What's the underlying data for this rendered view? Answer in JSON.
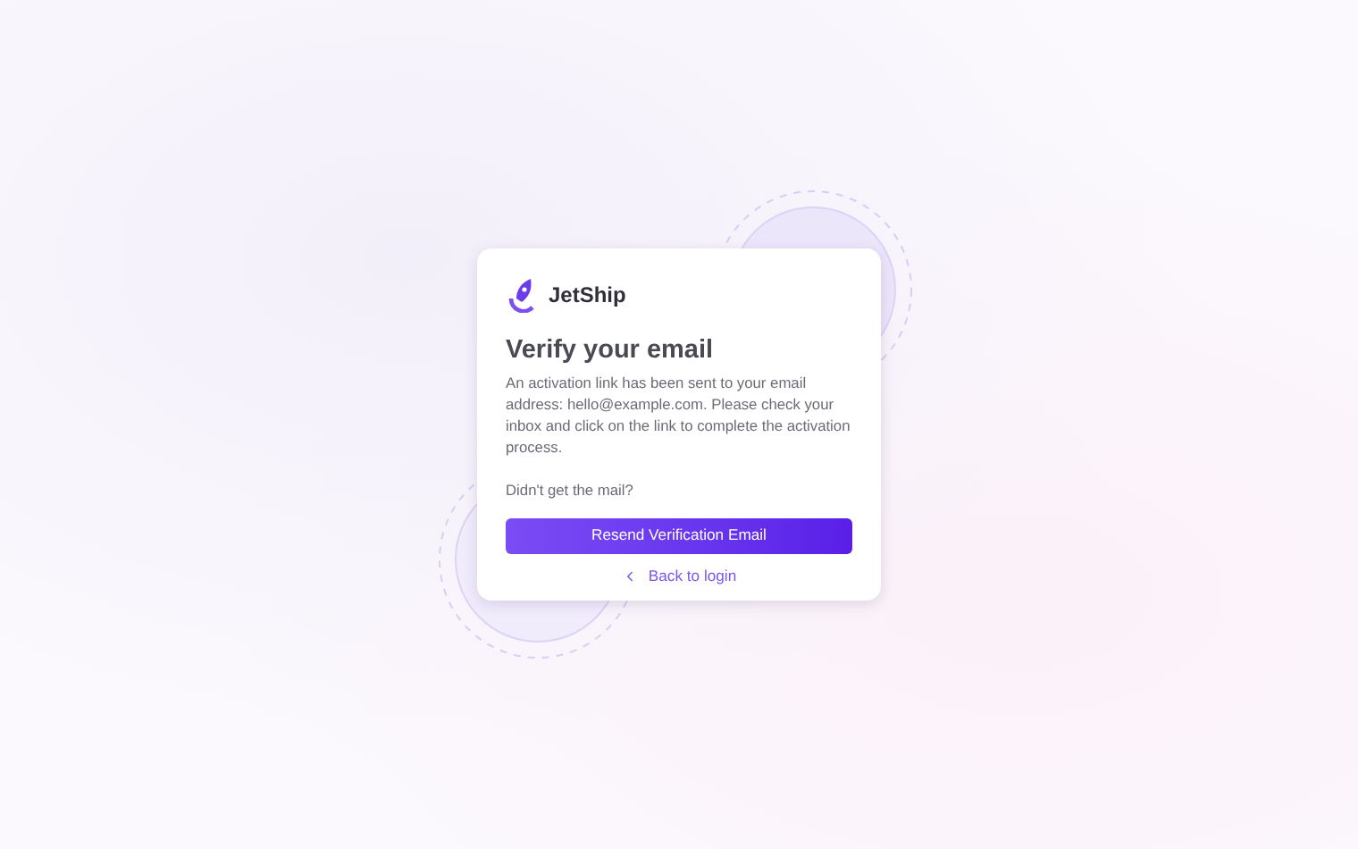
{
  "brand": {
    "name": "JetShip"
  },
  "title": "Verify your email",
  "message": "An activation link has been sent to your email address: hello@example.com. Please check your inbox and click on the link to complete the activation process.",
  "prompt": "Didn't get the mail?",
  "resend_button": "Resend Verification Email",
  "back_link": "Back to login"
}
